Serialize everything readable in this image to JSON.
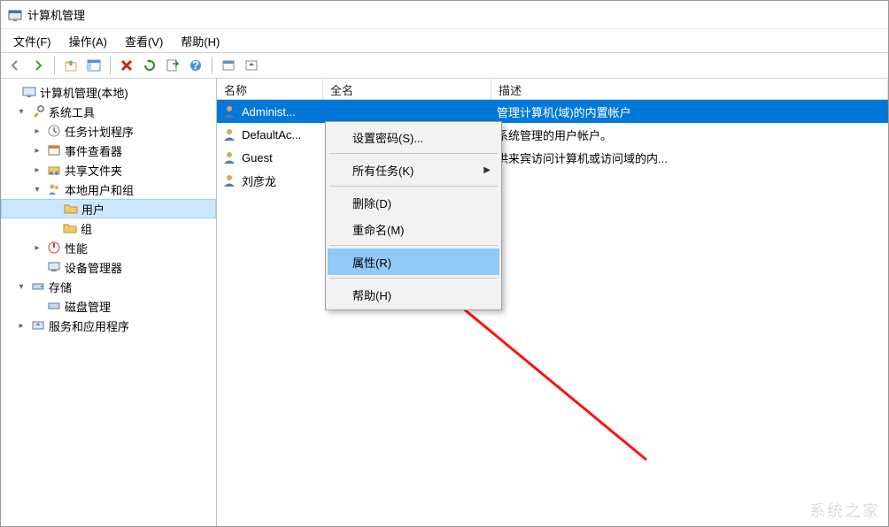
{
  "window": {
    "title": "计算机管理"
  },
  "menu": {
    "items": [
      {
        "label": "文件(F)"
      },
      {
        "label": "操作(A)"
      },
      {
        "label": "查看(V)"
      },
      {
        "label": "帮助(H)"
      }
    ]
  },
  "toolbar": {
    "back": "back-icon",
    "forward": "forward-icon",
    "up": "up-icon",
    "props": "properties-icon",
    "delete": "delete-icon",
    "refresh": "refresh-icon",
    "export": "export-icon",
    "help": "help-icon"
  },
  "tree": {
    "root": {
      "label": "计算机管理(本地)"
    },
    "systemTools": {
      "label": "系统工具"
    },
    "taskScheduler": {
      "label": "任务计划程序"
    },
    "eventViewer": {
      "label": "事件查看器"
    },
    "sharedFolders": {
      "label": "共享文件夹"
    },
    "localUsersGroups": {
      "label": "本地用户和组"
    },
    "users": {
      "label": "用户"
    },
    "groups": {
      "label": "组"
    },
    "performance": {
      "label": "性能"
    },
    "deviceManager": {
      "label": "设备管理器"
    },
    "storage": {
      "label": "存储"
    },
    "diskManagement": {
      "label": "磁盘管理"
    },
    "services": {
      "label": "服务和应用程序"
    }
  },
  "list": {
    "columns": {
      "name": "名称",
      "fullname": "全名",
      "description": "描述"
    },
    "rows": [
      {
        "name": "Administ...",
        "fullname": "",
        "description": "管理计算机(域)的内置帐户",
        "selected": true
      },
      {
        "name": "DefaultAc...",
        "fullname": "",
        "description": "系统管理的用户帐户。"
      },
      {
        "name": "Guest",
        "fullname": "",
        "description": "供来宾访问计算机或访问域的内..."
      },
      {
        "name": "刘彦龙",
        "fullname": "",
        "description": ""
      }
    ]
  },
  "contextMenu": {
    "setPassword": "设置密码(S)...",
    "allTasks": "所有任务(K)",
    "delete": "删除(D)",
    "rename": "重命名(M)",
    "properties": "属性(R)",
    "help": "帮助(H)"
  },
  "watermark": "系统之家"
}
